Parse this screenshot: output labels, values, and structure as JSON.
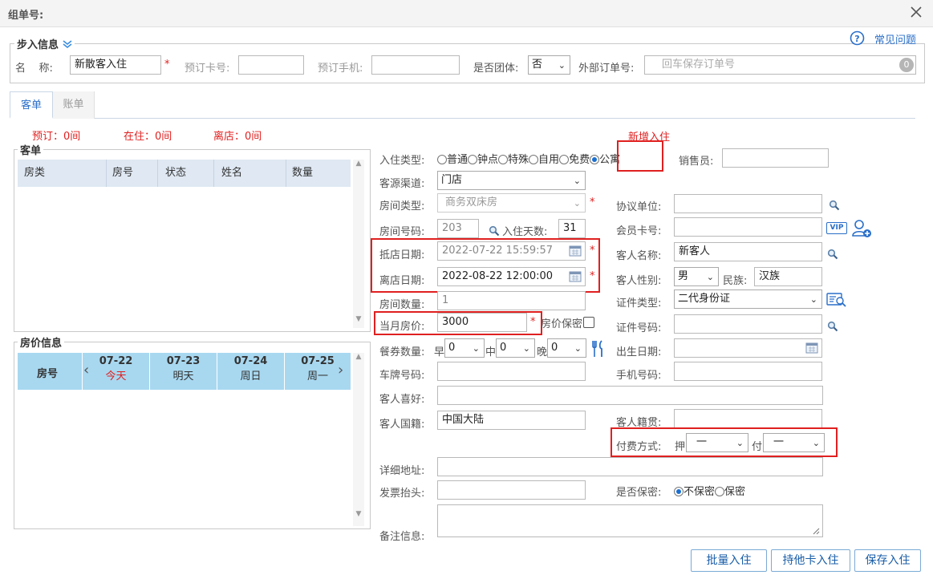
{
  "window": {
    "title": "组单号:"
  },
  "help": {
    "label": "常见问题"
  },
  "step": {
    "legend": "步入信息",
    "name_label": "名    称:",
    "name_value": "新散客入住",
    "card_label": "预订卡号:",
    "phone_label": "预订手机:",
    "group_label": "是否团体:",
    "group_value": "否",
    "ext_label": "外部订单号:",
    "ext_placeholder": "回车保存订单号",
    "ext_badge": "0"
  },
  "tabs": [
    {
      "label": "客单"
    },
    {
      "label": "账单"
    }
  ],
  "status": {
    "booked": "预订：0间",
    "staying": "在住：0间",
    "left": "离店：0间",
    "new_checkin": "新增入住"
  },
  "guest_list": {
    "legend": "客单",
    "columns": [
      "房类",
      "房号",
      "状态",
      "姓名",
      "数量"
    ]
  },
  "price_info": {
    "legend": "房价信息",
    "room_col": "房号",
    "days": [
      {
        "date": "07-22",
        "label": "今天",
        "today": true
      },
      {
        "date": "07-23",
        "label": "明天",
        "today": false
      },
      {
        "date": "07-24",
        "label": "周日",
        "today": false
      },
      {
        "date": "07-25",
        "label": "周一",
        "today": false
      }
    ]
  },
  "form": {
    "checkin_type_label": "入住类型:",
    "checkin_types": [
      "普通",
      "钟点",
      "特殊",
      "自用",
      "免费",
      "公寓"
    ],
    "checkin_type_selected": "公寓",
    "salesman_label": "销售员:",
    "source_label": "客源渠道:",
    "source_value": "门店",
    "room_type_label": "房间类型:",
    "room_type_value": "商务双床房",
    "agreement_label": "协议单位:",
    "room_no_label": "房间号码:",
    "room_no_value": "203",
    "days_label": "入住天数:",
    "days_value": "31",
    "member_label": "会员卡号:",
    "vip": "VIP",
    "arrive_label": "抵店日期:",
    "arrive_value": "2022-07-22 15:59:57",
    "guest_name_label": "客人名称:",
    "guest_name_value": "新客人",
    "leave_label": "离店日期:",
    "leave_value": "2022-08-22 12:00:00",
    "gender_label": "客人性别:",
    "gender_value": "男",
    "nation_label": "民族:",
    "nation_value": "汉族",
    "room_count_label": "房间数量:",
    "room_count_value": "1",
    "id_type_label": "证件类型:",
    "id_type_value": "二代身份证",
    "monthly_price_label": "当月房价:",
    "monthly_price_value": "3000",
    "price_secret_label": "房价保密",
    "id_no_label": "证件号码:",
    "meal_label": "餐券数量:",
    "breakfast": "早",
    "lunch": "中",
    "dinner": "晚",
    "meal_values": [
      "0",
      "0",
      "0"
    ],
    "birth_label": "出生日期:",
    "plate_label": "车牌号码:",
    "mobile_label": "手机号码:",
    "hobby_label": "客人喜好:",
    "nationality_label": "客人国籍:",
    "nationality_value": "中国大陆",
    "origin_label": "客人籍贯:",
    "pay_label": "付费方式:",
    "deposit_short": "押",
    "pay_short": "付",
    "deposit_value": "一",
    "pay_value": "一",
    "address_label": "详细地址:",
    "invoice_label": "发票抬头:",
    "secret_label": "是否保密:",
    "secret_options": [
      "不保密",
      "保密"
    ],
    "secret_selected": "不保密",
    "remark_label": "备注信息:"
  },
  "buttons": {
    "batch": "批量入住",
    "other_card": "持他卡入住",
    "save": "保存入住"
  }
}
